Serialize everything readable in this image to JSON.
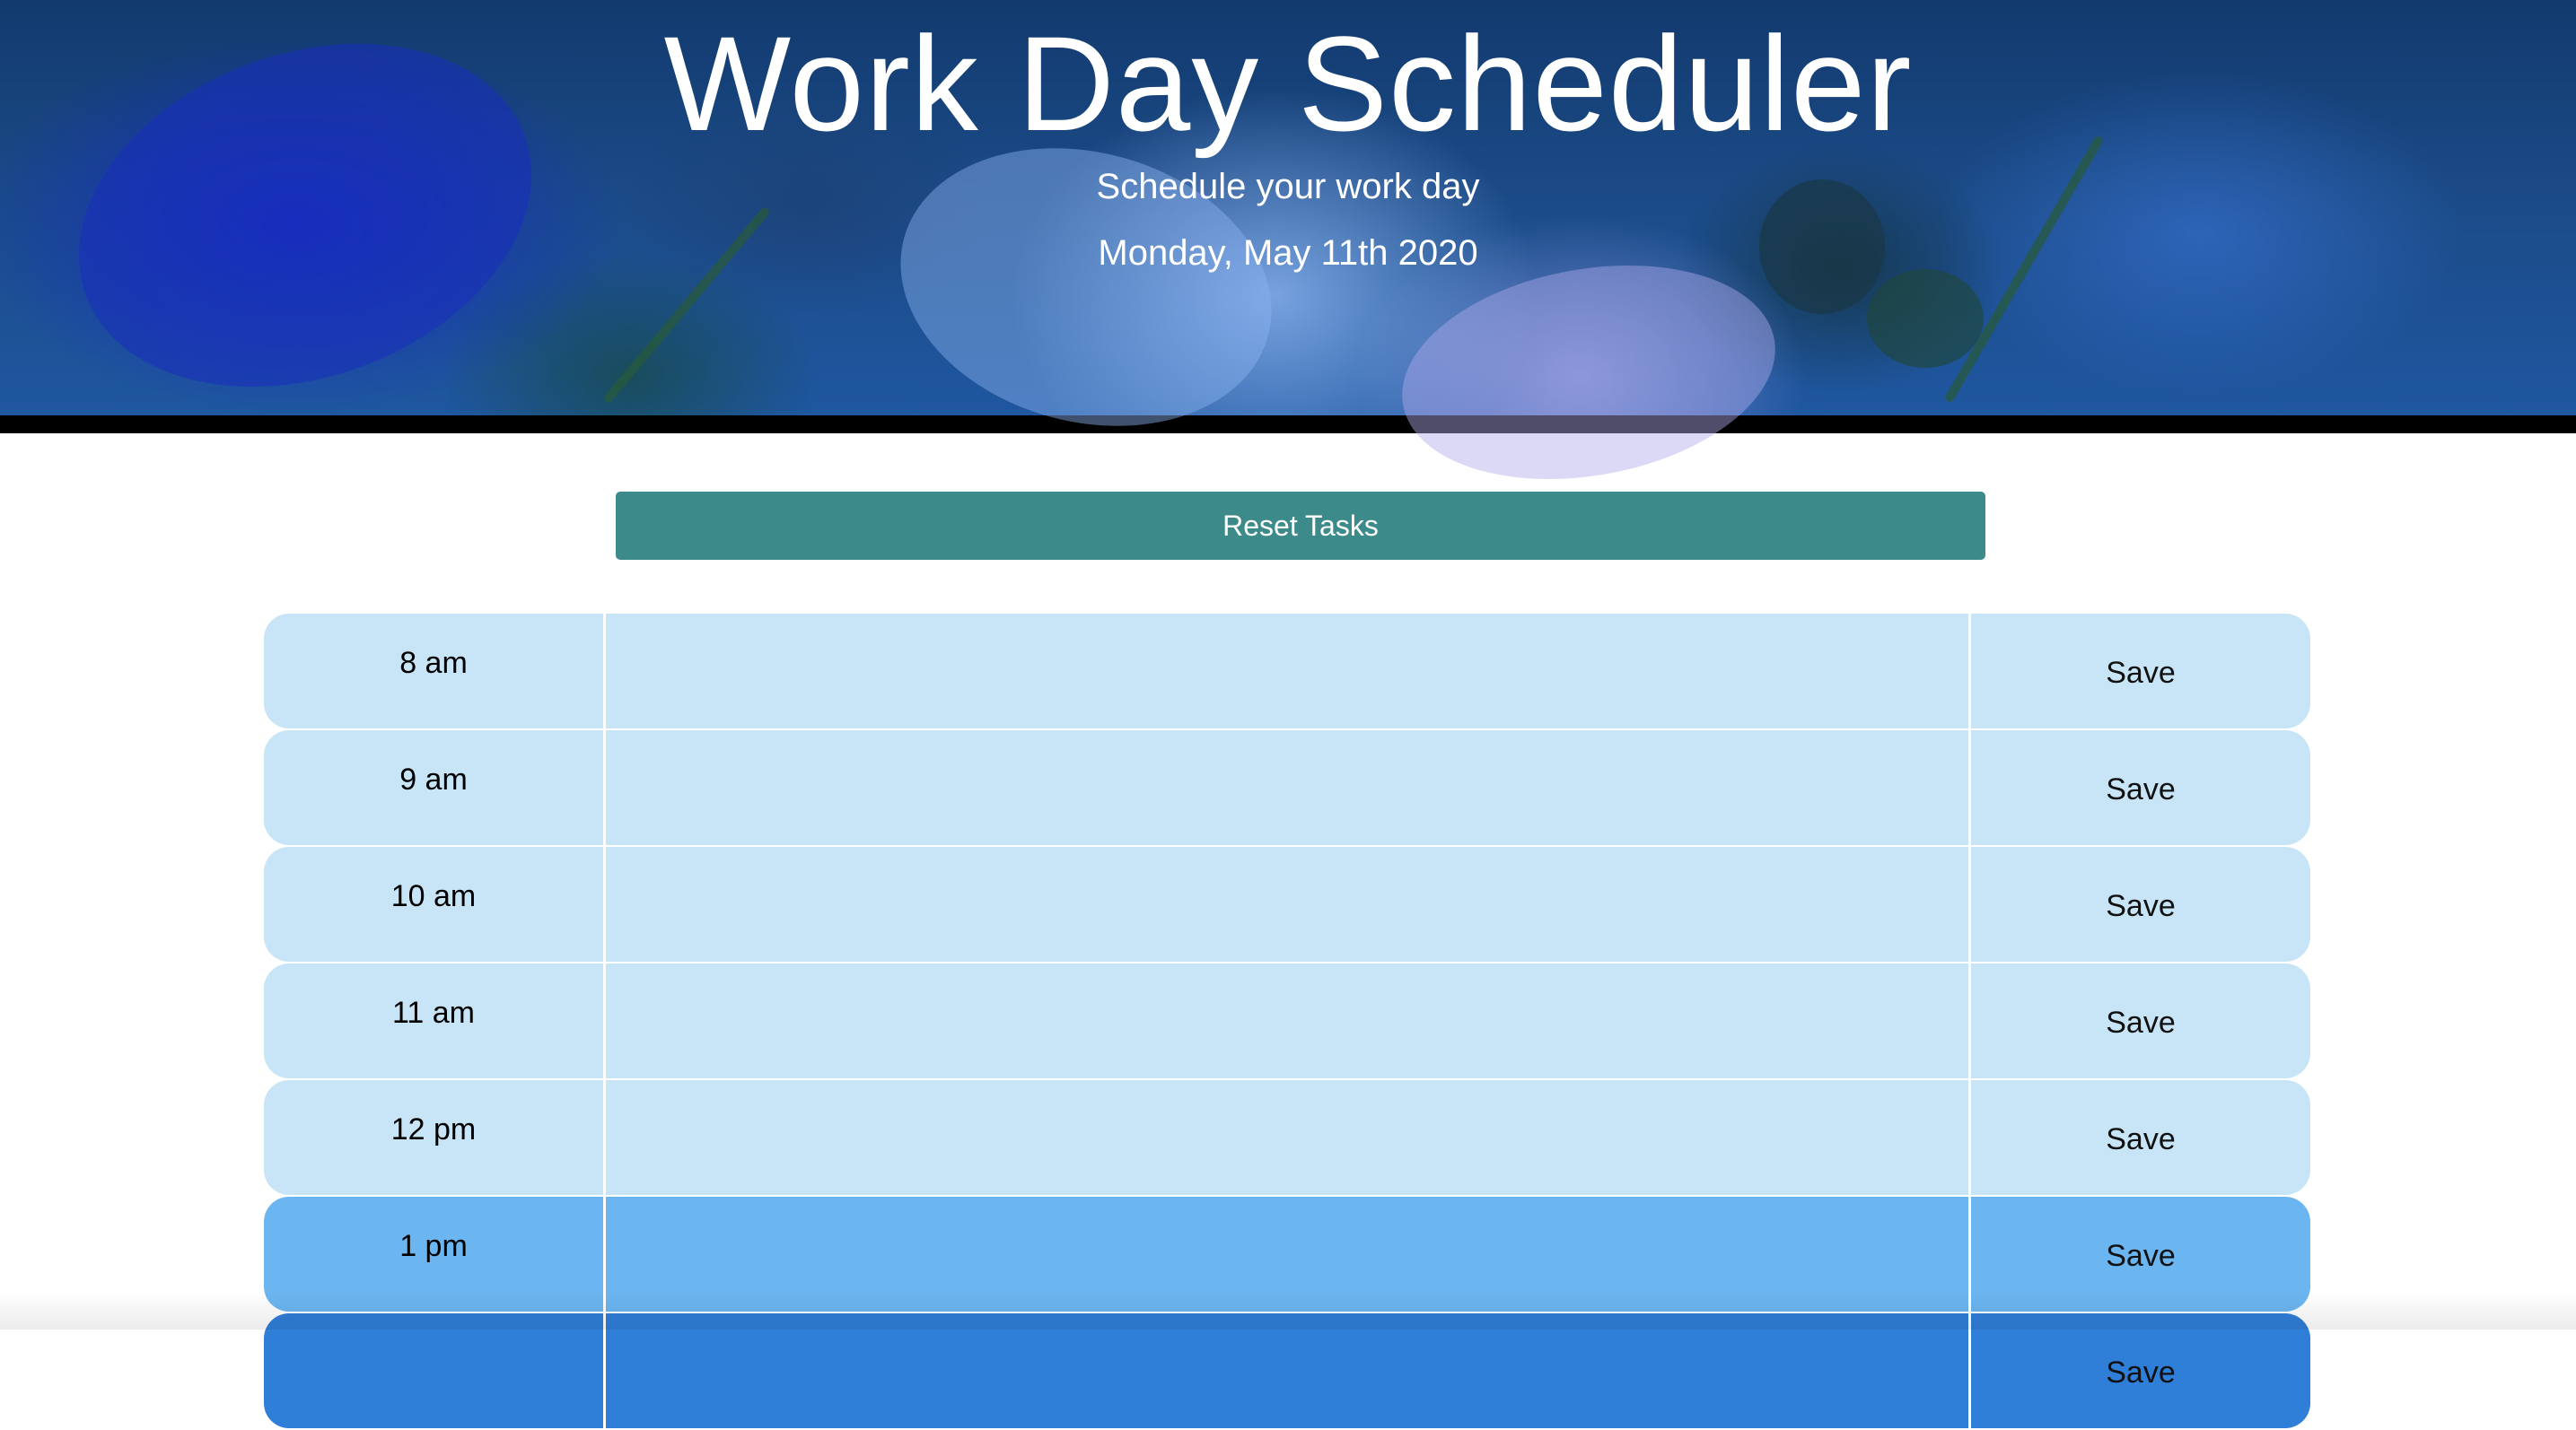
{
  "header": {
    "title": "Work Day Scheduler",
    "subtitle": "Schedule your work day",
    "date": "Monday, May 11th 2020"
  },
  "reset_button": {
    "label": "Reset Tasks"
  },
  "schedule": {
    "save_label": "Save",
    "rows": [
      {
        "hour": "8 am",
        "task": "",
        "status": "past"
      },
      {
        "hour": "9 am",
        "task": "",
        "status": "past"
      },
      {
        "hour": "10 am",
        "task": "",
        "status": "past"
      },
      {
        "hour": "11 am",
        "task": "",
        "status": "past"
      },
      {
        "hour": "12 pm",
        "task": "",
        "status": "past"
      },
      {
        "hour": "1 pm",
        "task": "",
        "status": "present"
      },
      {
        "hour": "",
        "task": "",
        "status": "future"
      }
    ]
  },
  "colors": {
    "past": "#c7e5f7",
    "present": "#6bb5f0",
    "future": "#2f7ed8",
    "reset_button": "#3d8a8a"
  }
}
